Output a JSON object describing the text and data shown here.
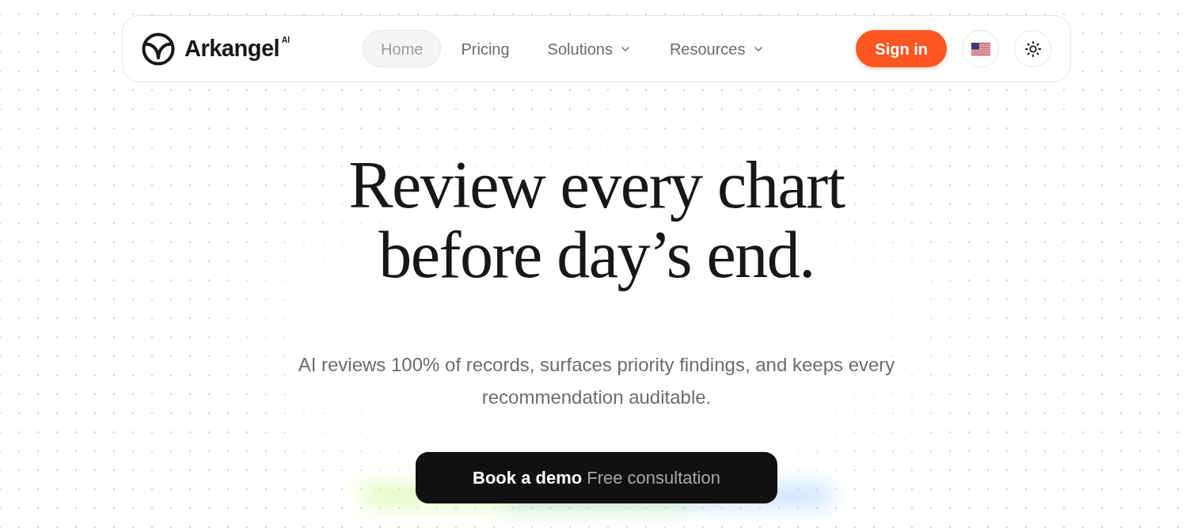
{
  "brand": {
    "name": "Arkangel",
    "tag": "AI"
  },
  "nav": {
    "links": [
      {
        "label": "Home",
        "selected": true,
        "kind": "link"
      },
      {
        "label": "Pricing",
        "selected": false,
        "kind": "link"
      },
      {
        "label": "Solutions",
        "selected": false,
        "kind": "menu"
      },
      {
        "label": "Resources",
        "selected": false,
        "kind": "menu"
      }
    ],
    "sign_in": "Sign in"
  },
  "hero": {
    "heading": "Review every chart before day’s end.",
    "subtitle": "AI reviews 100% of records, surfaces priority findings, and keeps every recommendation auditable.",
    "cta": {
      "label": "Book a demo",
      "note": "Free consultation"
    }
  }
}
